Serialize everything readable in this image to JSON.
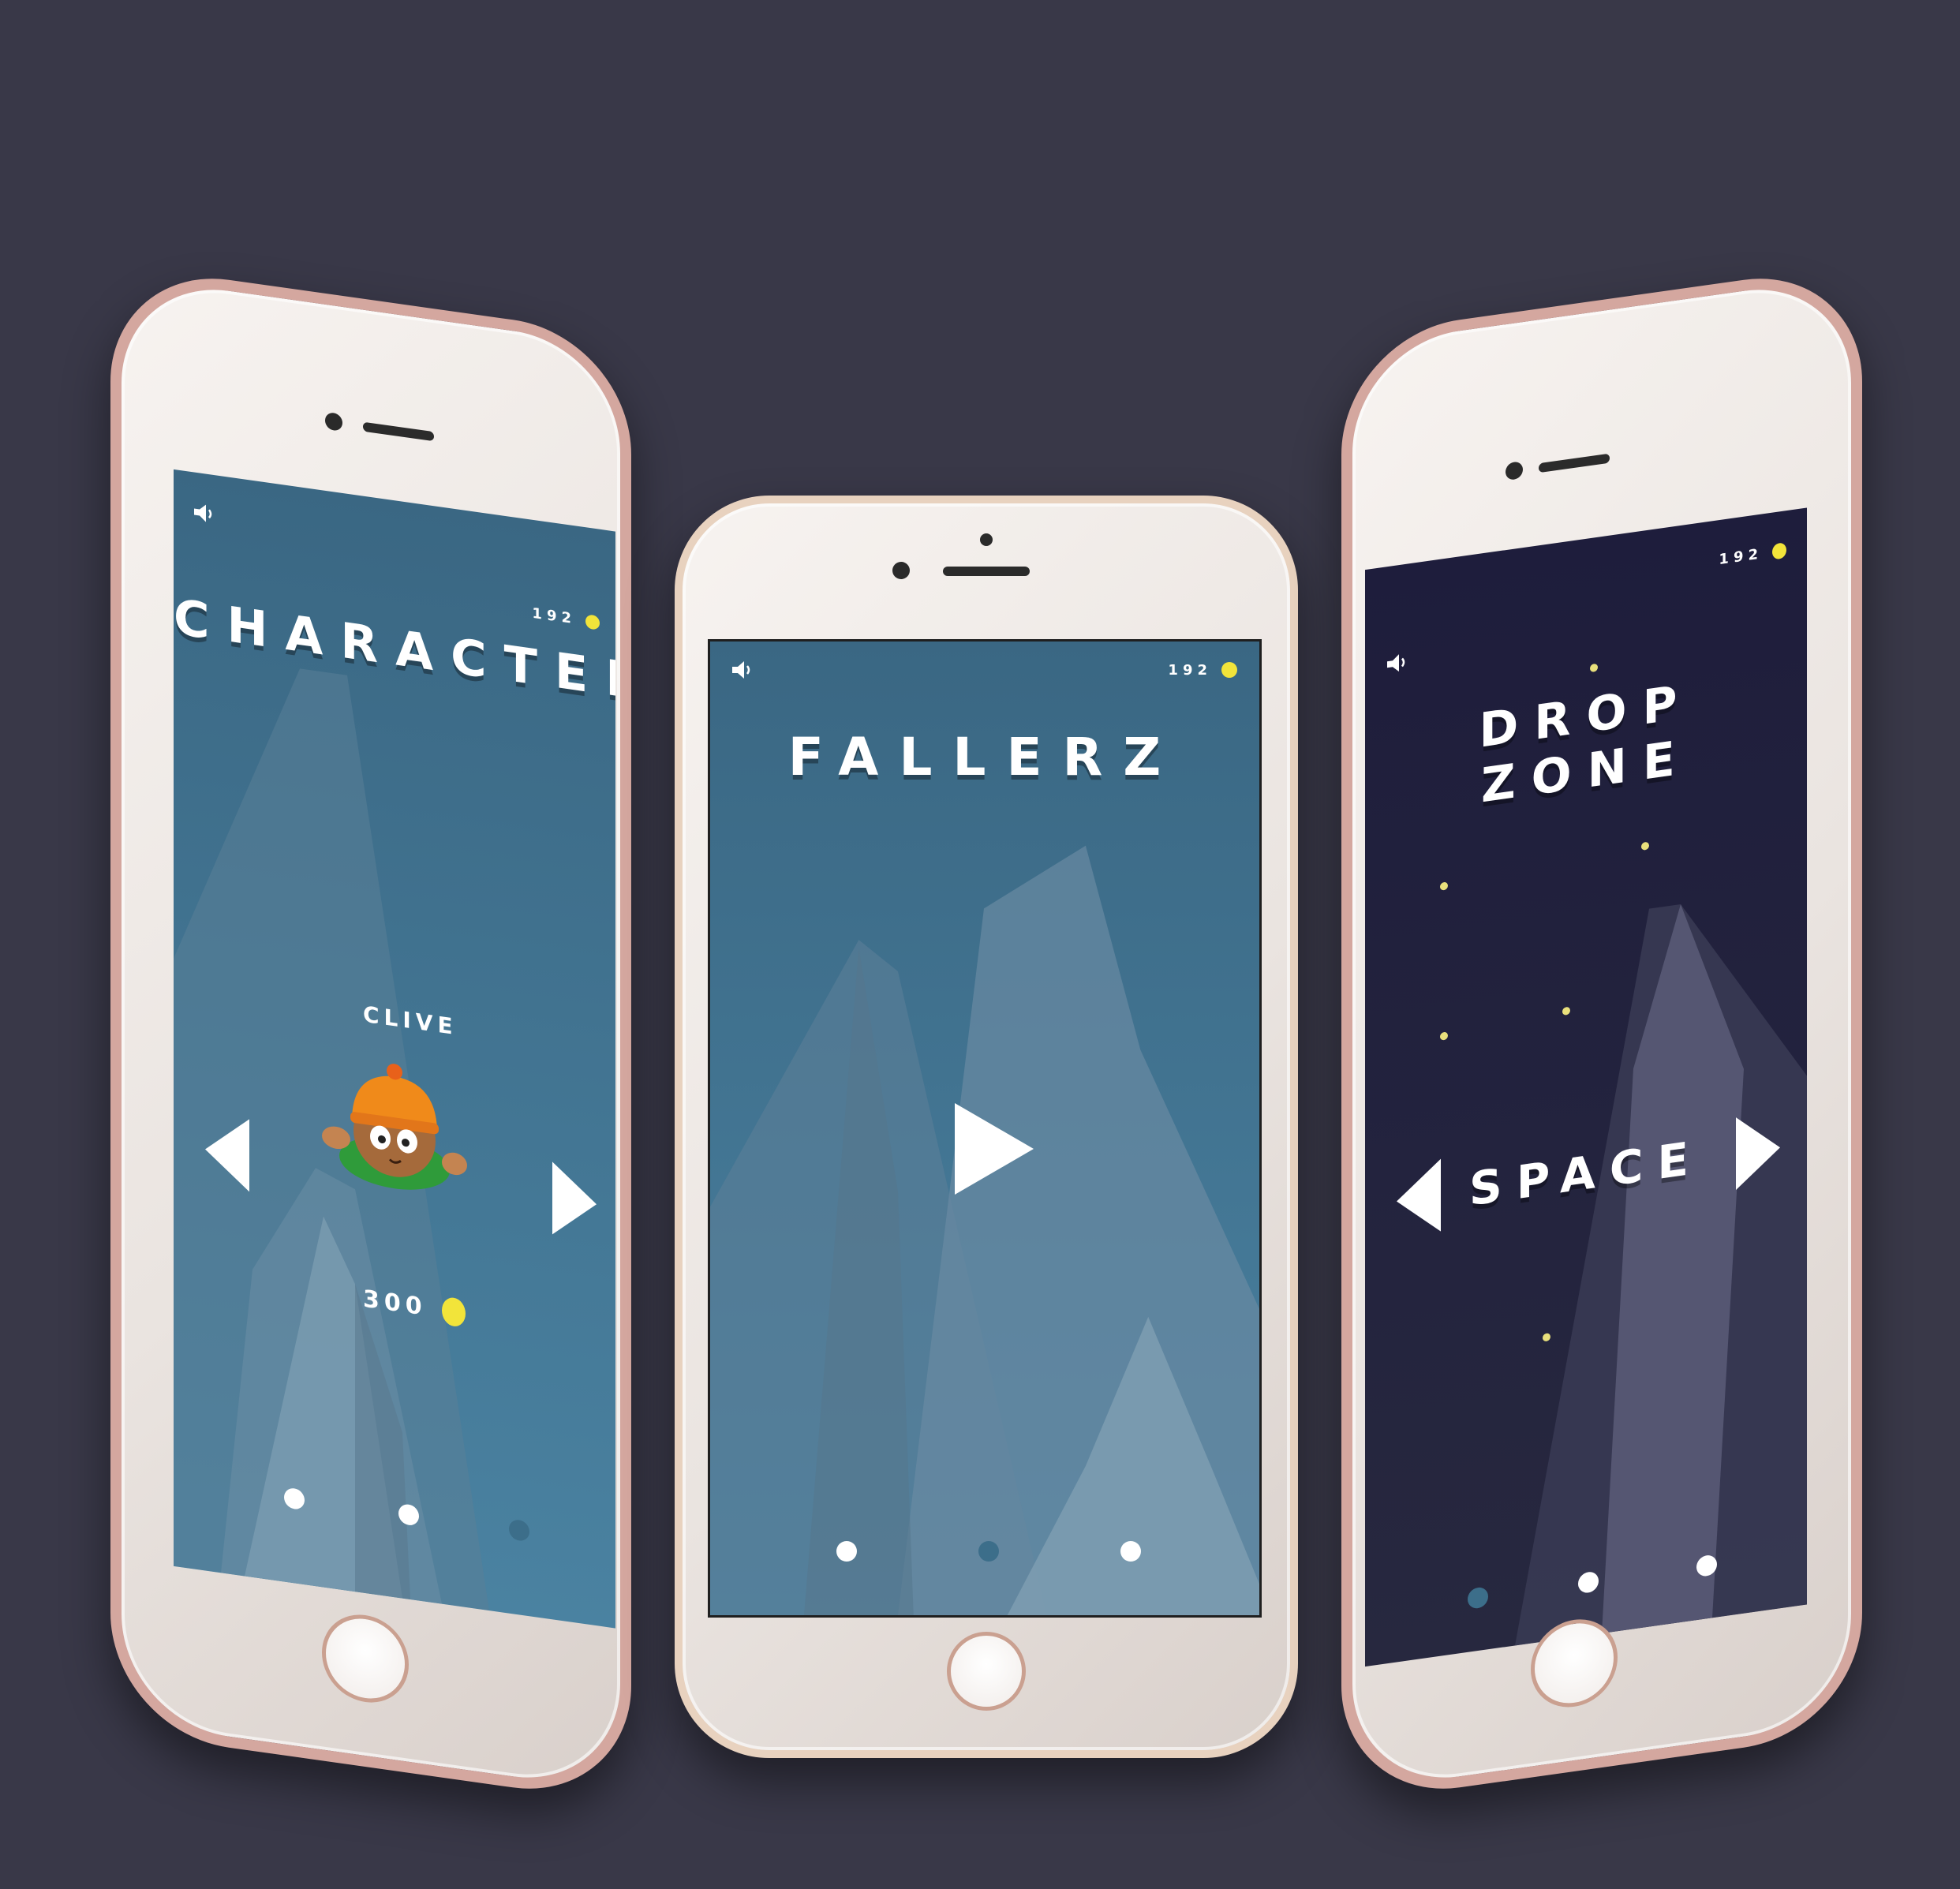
{
  "phones": [
    {
      "screen": "character-select",
      "sound_icon": "speaker-icon",
      "coins": "192",
      "title": "CHARACTER",
      "character_name": "CLIVE",
      "price": "300",
      "page_dots": [
        "inactive",
        "inactive",
        "active"
      ]
    },
    {
      "screen": "main-menu",
      "sound_icon": "speaker-icon",
      "coins": "192",
      "title": "FALLERZ",
      "play_icon": "play-icon",
      "page_dots": [
        "inactive",
        "active",
        "inactive"
      ]
    },
    {
      "screen": "drop-zone-select",
      "sound_icon": "speaker-icon",
      "coins": "192",
      "title": "DROP ZONE",
      "zone_name": "SPACE",
      "page_dots": [
        "active",
        "inactive",
        "inactive"
      ]
    }
  ],
  "colors": {
    "background": "#393848",
    "sky_blue": "#3d6e8c",
    "space_navy": "#1e1d3c",
    "coin_yellow": "#f2e43a",
    "active_dot": "#3c6e8a"
  }
}
